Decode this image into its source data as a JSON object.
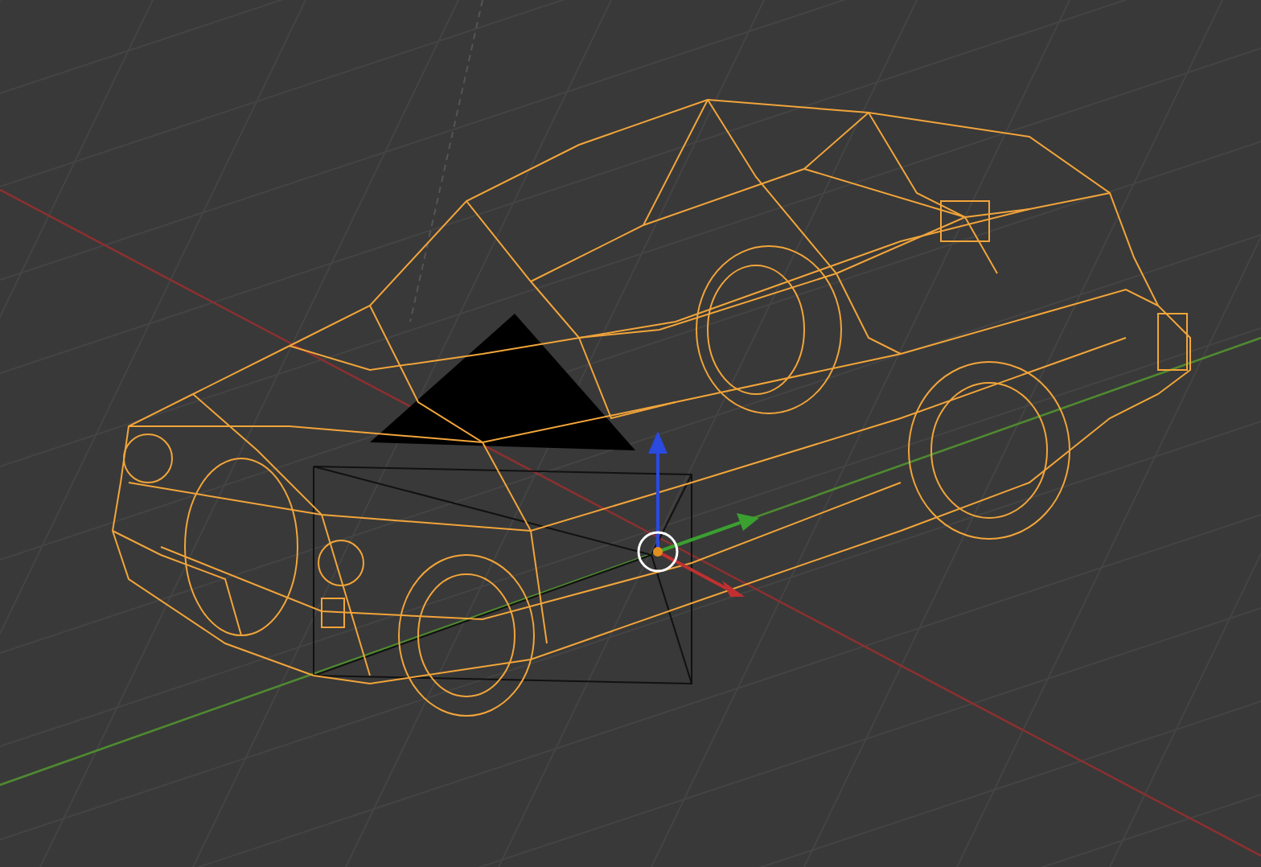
{
  "viewport": {
    "wireframe": true,
    "grid": true
  }
}
